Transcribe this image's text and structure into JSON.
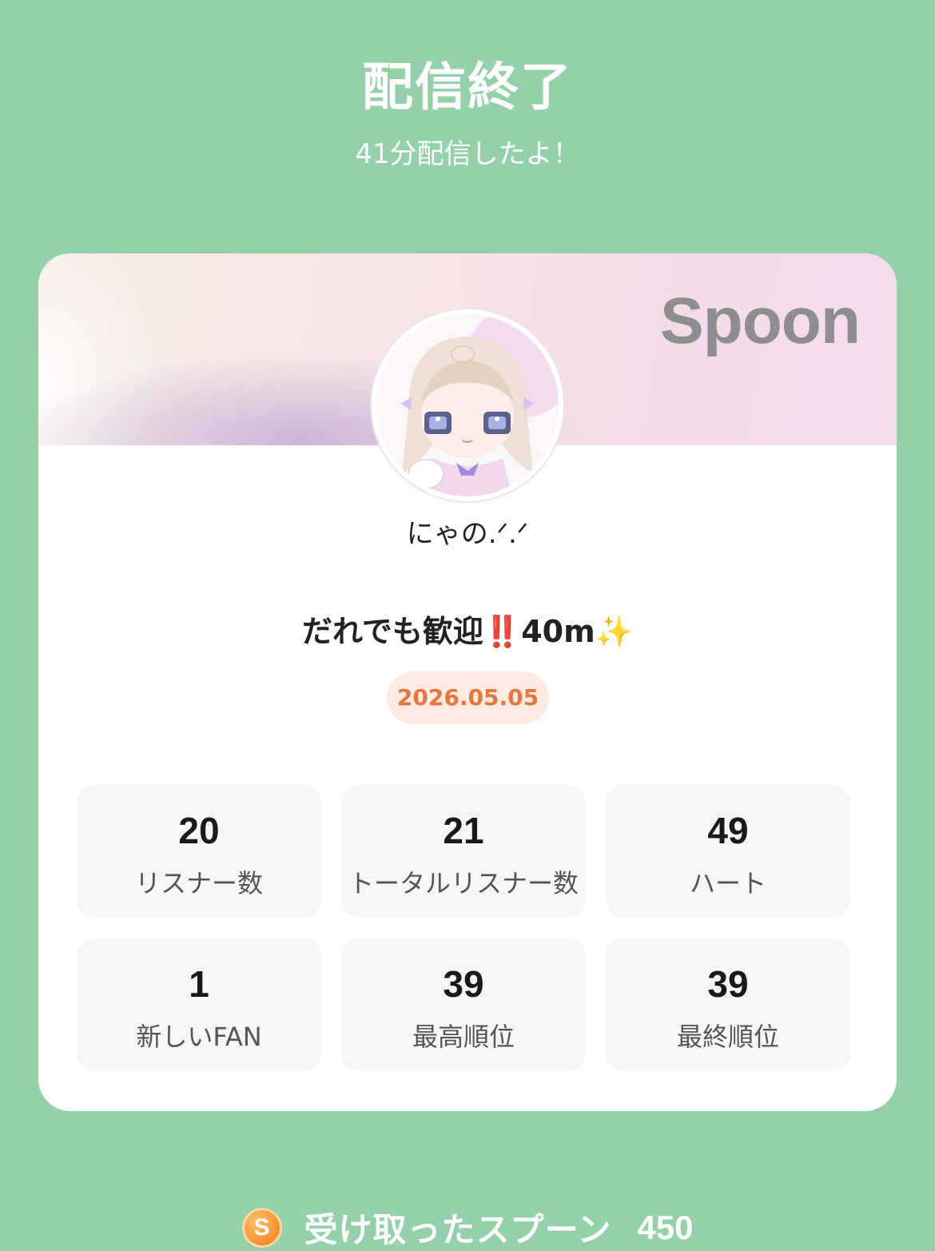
{
  "header": {
    "title": "配信終了",
    "subtitle": "41分配信したよ！"
  },
  "card": {
    "brand": "Spoon",
    "nickname": "にゃの.ᐟ.ᐟ",
    "live_title_text": "だれでも歓迎",
    "live_title_bang": "‼️",
    "live_title_tail": "40m",
    "live_title_spark": "✨",
    "date": "2026.05.05",
    "stats": [
      {
        "value": "20",
        "label": "リスナー数"
      },
      {
        "value": "21",
        "label": "トータルリスナー数"
      },
      {
        "value": "49",
        "label": "ハート"
      },
      {
        "value": "1",
        "label": "新しいFAN"
      },
      {
        "value": "39",
        "label": "最高順位"
      },
      {
        "value": "39",
        "label": "最終順位"
      }
    ]
  },
  "footer": {
    "coin_letter": "S",
    "spoon_label": "受け取ったスプーン",
    "spoon_count": "450"
  },
  "colors": {
    "background": "#94d1aa",
    "date_text": "#e8753c",
    "date_pill": "#fbebe3",
    "coin": "#f59230"
  },
  "icons": {
    "avatar": "anime-girl-avatar",
    "coin": "spoon-coin-icon"
  }
}
